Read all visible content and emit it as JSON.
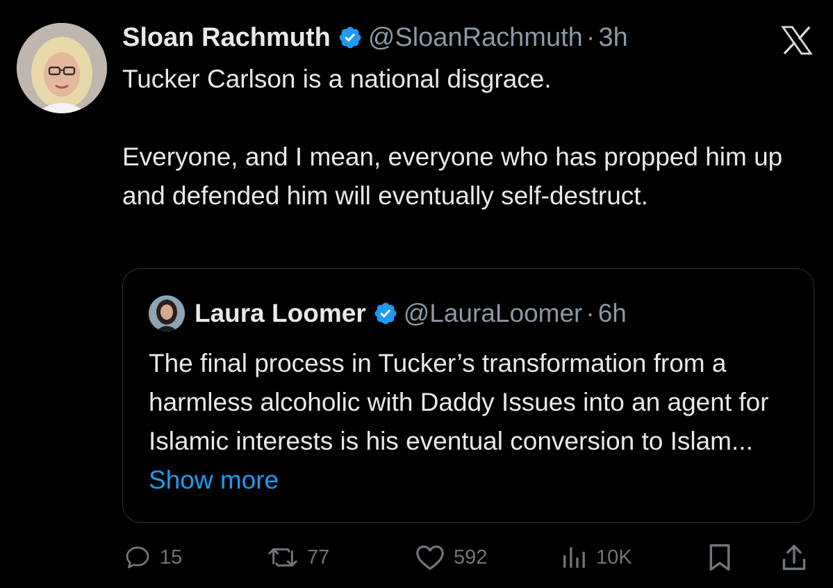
{
  "post": {
    "author_name": "Sloan Rachmuth",
    "handle": "@SloanRachmuth",
    "separator": "·",
    "time": "3h",
    "paragraphs": [
      "Tucker Carlson is a national disgrace.",
      "Everyone, and I mean, everyone who has propped him up and defended him will eventually self-destruct."
    ]
  },
  "quoted_post": {
    "author_name": "Laura Loomer",
    "handle": "@LauraLoomer",
    "separator": "·",
    "time": "6h",
    "text": "The final process in Tucker’s transformation from a harmless alcoholic with Daddy Issues into an agent for Islamic interests is his eventual conversion to Islam...",
    "show_more": " Show more"
  },
  "actions": {
    "replies": "15",
    "reposts": "77",
    "likes": "592",
    "views": "10K"
  },
  "icons": {
    "verified": "verified-badge-icon",
    "platform": "x-logo-icon",
    "reply": "reply-icon",
    "repost": "repost-icon",
    "like": "heart-icon",
    "views": "views-icon",
    "bookmark": "bookmark-icon",
    "share": "share-icon"
  },
  "colors": {
    "background": "#000000",
    "text_primary": "#e7e9ea",
    "text_secondary": "#8b98a5",
    "accent": "#1d9bf0",
    "border": "#2f3336"
  }
}
